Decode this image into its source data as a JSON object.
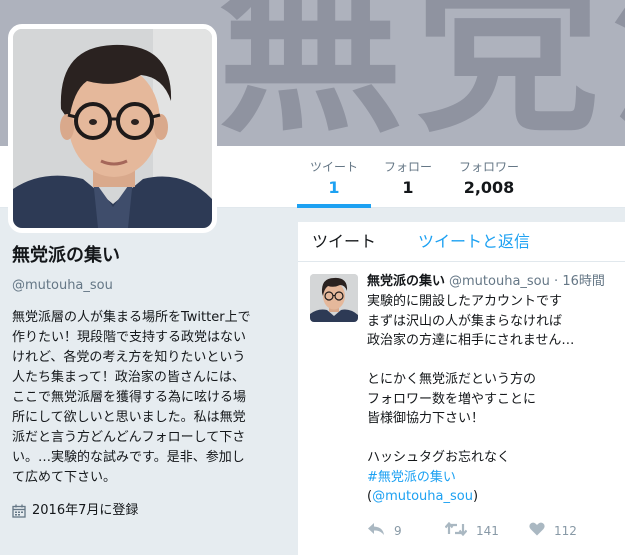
{
  "banner": {
    "text": "無党派"
  },
  "stats": {
    "tweets": {
      "label": "ツイート",
      "value": "1"
    },
    "following": {
      "label": "フォロー",
      "value": "1"
    },
    "followers": {
      "label": "フォロワー",
      "value": "2,008"
    }
  },
  "profile": {
    "name": "無党派の集い",
    "handle": "@mutouha_sou",
    "bio_lines": [
      "無党派層の人が集まる場所をTwitter上で",
      "作りたい！現段階で支持する政党はない",
      "けれど、各党の考え方を知りたいという",
      "人たち集まって！政治家の皆さんには、",
      "ここで無党派層を獲得する為に呟ける場",
      "所にして欲しいと思いました。私は無党",
      "派だと言う方どんどんフォローして下さ",
      "い。…実験的な試みです。是非、参加し",
      "て広めて下さい。"
    ],
    "joined": "2016年7月に登録",
    "joined_icon": "calendar-icon"
  },
  "timeline": {
    "tabs": [
      "ツイート",
      "ツイートと返信"
    ],
    "active_tab": "ツイート"
  },
  "tweet": {
    "name": "無党派の集い",
    "handle": "@mutouha_sou",
    "separator": "·",
    "time": "16時間",
    "lines": [
      "実験的に開設したアカウントです",
      "まずは沢山の人が集まらなければ",
      "政治家の方達に相手にされません…",
      "",
      "とにかく無党派だという方の",
      "フォロワー数を増やすことに",
      "皆様御協力下さい！",
      "",
      "ハッシュタグお忘れなく",
      "#無党派の集い",
      "(@mutouha_sou)"
    ],
    "hashtag": "#無党派の集い",
    "mention": "@mutouha_sou",
    "actions": {
      "reply": {
        "icon": "reply-icon",
        "count": "9"
      },
      "retweet": {
        "icon": "retweet-icon",
        "count": "141"
      },
      "like": {
        "icon": "heart-icon",
        "count": "112"
      }
    }
  },
  "colors": {
    "accent": "#1da1f2",
    "text": "#14171a",
    "muted": "#657786",
    "page_bg": "#e6ecf0"
  }
}
